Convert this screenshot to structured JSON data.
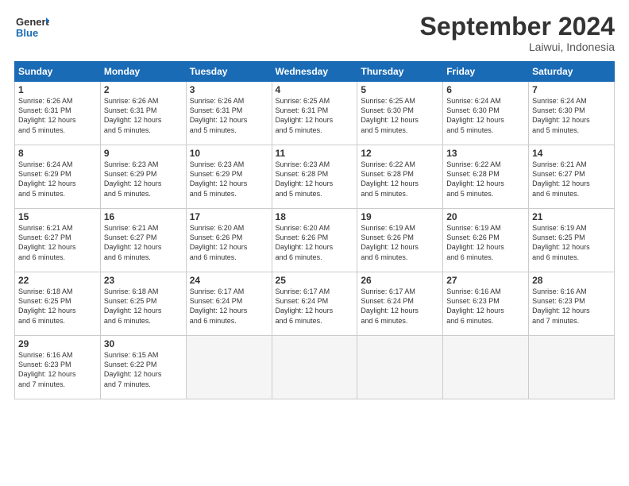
{
  "logo": {
    "line1": "General",
    "line2": "Blue"
  },
  "title": "September 2024",
  "subtitle": "Laiwui, Indonesia",
  "header_days": [
    "Sunday",
    "Monday",
    "Tuesday",
    "Wednesday",
    "Thursday",
    "Friday",
    "Saturday"
  ],
  "weeks": [
    [
      {
        "day": "1",
        "info": "Sunrise: 6:26 AM\nSunset: 6:31 PM\nDaylight: 12 hours\nand 5 minutes."
      },
      {
        "day": "2",
        "info": "Sunrise: 6:26 AM\nSunset: 6:31 PM\nDaylight: 12 hours\nand 5 minutes."
      },
      {
        "day": "3",
        "info": "Sunrise: 6:26 AM\nSunset: 6:31 PM\nDaylight: 12 hours\nand 5 minutes."
      },
      {
        "day": "4",
        "info": "Sunrise: 6:25 AM\nSunset: 6:31 PM\nDaylight: 12 hours\nand 5 minutes."
      },
      {
        "day": "5",
        "info": "Sunrise: 6:25 AM\nSunset: 6:30 PM\nDaylight: 12 hours\nand 5 minutes."
      },
      {
        "day": "6",
        "info": "Sunrise: 6:24 AM\nSunset: 6:30 PM\nDaylight: 12 hours\nand 5 minutes."
      },
      {
        "day": "7",
        "info": "Sunrise: 6:24 AM\nSunset: 6:30 PM\nDaylight: 12 hours\nand 5 minutes."
      }
    ],
    [
      {
        "day": "8",
        "info": "Sunrise: 6:24 AM\nSunset: 6:29 PM\nDaylight: 12 hours\nand 5 minutes."
      },
      {
        "day": "9",
        "info": "Sunrise: 6:23 AM\nSunset: 6:29 PM\nDaylight: 12 hours\nand 5 minutes."
      },
      {
        "day": "10",
        "info": "Sunrise: 6:23 AM\nSunset: 6:29 PM\nDaylight: 12 hours\nand 5 minutes."
      },
      {
        "day": "11",
        "info": "Sunrise: 6:23 AM\nSunset: 6:28 PM\nDaylight: 12 hours\nand 5 minutes."
      },
      {
        "day": "12",
        "info": "Sunrise: 6:22 AM\nSunset: 6:28 PM\nDaylight: 12 hours\nand 5 minutes."
      },
      {
        "day": "13",
        "info": "Sunrise: 6:22 AM\nSunset: 6:28 PM\nDaylight: 12 hours\nand 5 minutes."
      },
      {
        "day": "14",
        "info": "Sunrise: 6:21 AM\nSunset: 6:27 PM\nDaylight: 12 hours\nand 6 minutes."
      }
    ],
    [
      {
        "day": "15",
        "info": "Sunrise: 6:21 AM\nSunset: 6:27 PM\nDaylight: 12 hours\nand 6 minutes."
      },
      {
        "day": "16",
        "info": "Sunrise: 6:21 AM\nSunset: 6:27 PM\nDaylight: 12 hours\nand 6 minutes."
      },
      {
        "day": "17",
        "info": "Sunrise: 6:20 AM\nSunset: 6:26 PM\nDaylight: 12 hours\nand 6 minutes."
      },
      {
        "day": "18",
        "info": "Sunrise: 6:20 AM\nSunset: 6:26 PM\nDaylight: 12 hours\nand 6 minutes."
      },
      {
        "day": "19",
        "info": "Sunrise: 6:19 AM\nSunset: 6:26 PM\nDaylight: 12 hours\nand 6 minutes."
      },
      {
        "day": "20",
        "info": "Sunrise: 6:19 AM\nSunset: 6:26 PM\nDaylight: 12 hours\nand 6 minutes."
      },
      {
        "day": "21",
        "info": "Sunrise: 6:19 AM\nSunset: 6:25 PM\nDaylight: 12 hours\nand 6 minutes."
      }
    ],
    [
      {
        "day": "22",
        "info": "Sunrise: 6:18 AM\nSunset: 6:25 PM\nDaylight: 12 hours\nand 6 minutes."
      },
      {
        "day": "23",
        "info": "Sunrise: 6:18 AM\nSunset: 6:25 PM\nDaylight: 12 hours\nand 6 minutes."
      },
      {
        "day": "24",
        "info": "Sunrise: 6:17 AM\nSunset: 6:24 PM\nDaylight: 12 hours\nand 6 minutes."
      },
      {
        "day": "25",
        "info": "Sunrise: 6:17 AM\nSunset: 6:24 PM\nDaylight: 12 hours\nand 6 minutes."
      },
      {
        "day": "26",
        "info": "Sunrise: 6:17 AM\nSunset: 6:24 PM\nDaylight: 12 hours\nand 6 minutes."
      },
      {
        "day": "27",
        "info": "Sunrise: 6:16 AM\nSunset: 6:23 PM\nDaylight: 12 hours\nand 6 minutes."
      },
      {
        "day": "28",
        "info": "Sunrise: 6:16 AM\nSunset: 6:23 PM\nDaylight: 12 hours\nand 7 minutes."
      }
    ],
    [
      {
        "day": "29",
        "info": "Sunrise: 6:16 AM\nSunset: 6:23 PM\nDaylight: 12 hours\nand 7 minutes."
      },
      {
        "day": "30",
        "info": "Sunrise: 6:15 AM\nSunset: 6:22 PM\nDaylight: 12 hours\nand 7 minutes."
      },
      {
        "day": "",
        "info": ""
      },
      {
        "day": "",
        "info": ""
      },
      {
        "day": "",
        "info": ""
      },
      {
        "day": "",
        "info": ""
      },
      {
        "day": "",
        "info": ""
      }
    ]
  ]
}
